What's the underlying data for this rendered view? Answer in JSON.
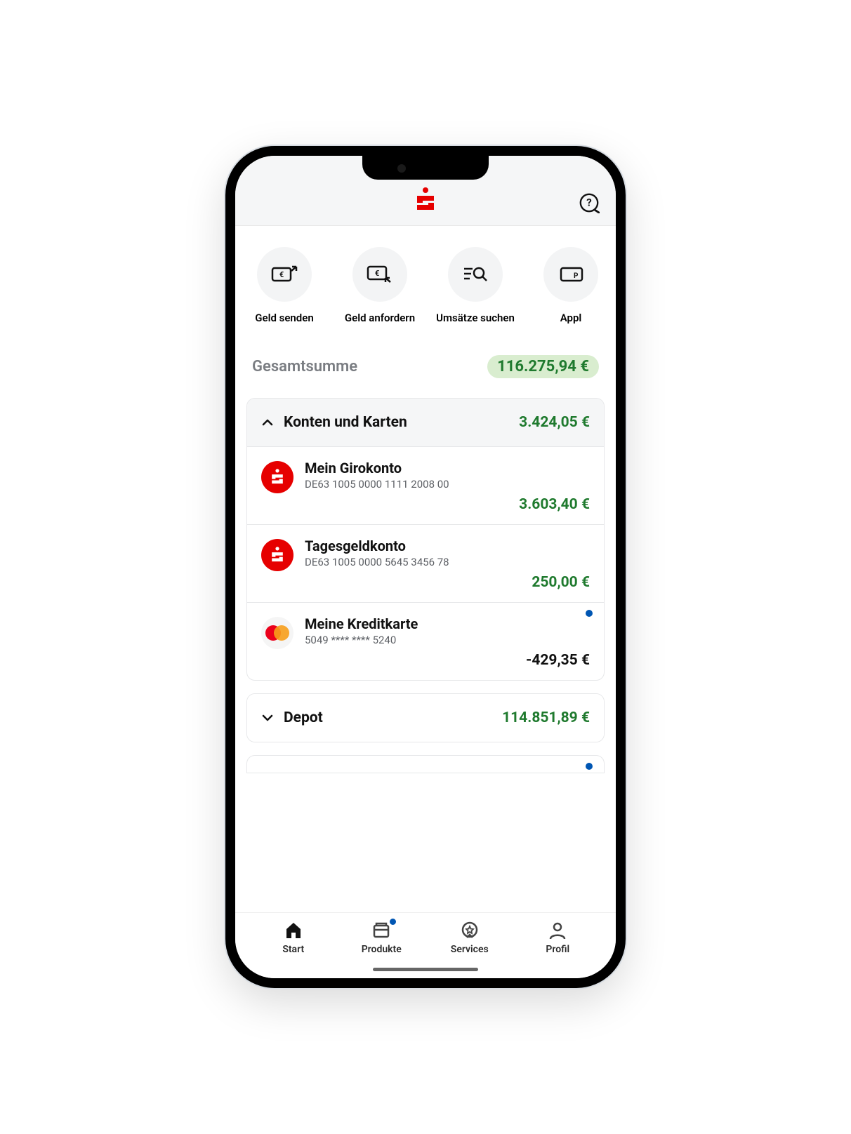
{
  "header": {
    "brand": "Sparkasse"
  },
  "quick_actions": [
    {
      "label": "Geld senden",
      "icon": "send-money"
    },
    {
      "label": "Geld anfordern",
      "icon": "request-money"
    },
    {
      "label": "Umsätze suchen",
      "icon": "search-transactions"
    },
    {
      "label": "Appl",
      "icon": "apple-pay"
    }
  ],
  "total": {
    "label": "Gesamtsumme",
    "amount": "116.275,94 €"
  },
  "sections": [
    {
      "title": "Konten und Karten",
      "amount": "3.424,05 €",
      "expanded": true,
      "accounts": [
        {
          "name": "Mein Girokonto",
          "number": "DE63 1005 0000 1111 2008 00",
          "amount": "3.603,40 €",
          "positive": true,
          "icon": "sparkasse"
        },
        {
          "name": "Tagesgeldkonto",
          "number": "DE63 1005 0000 5645 3456 78",
          "amount": "250,00 €",
          "positive": true,
          "icon": "sparkasse"
        },
        {
          "name": "Meine Kreditkarte",
          "number": "5049 **** **** 5240",
          "amount": "-429,35 €",
          "positive": false,
          "icon": "mastercard",
          "notification": true
        }
      ]
    },
    {
      "title": "Depot",
      "amount": "114.851,89 €",
      "expanded": false
    }
  ],
  "nav": [
    {
      "label": "Start",
      "icon": "home",
      "active": true
    },
    {
      "label": "Produkte",
      "icon": "products",
      "notification": true
    },
    {
      "label": "Services",
      "icon": "services"
    },
    {
      "label": "Profil",
      "icon": "profile"
    }
  ]
}
